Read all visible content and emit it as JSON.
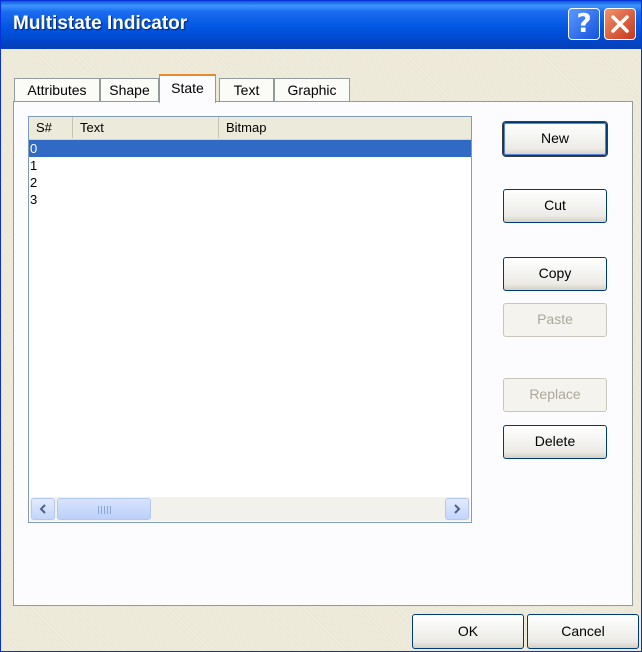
{
  "window": {
    "title": "Multistate Indicator"
  },
  "titlebar": {
    "help_label": "?"
  },
  "tabs": [
    {
      "label": "Attributes",
      "active": false
    },
    {
      "label": "Shape",
      "active": false
    },
    {
      "label": "State",
      "active": true
    },
    {
      "label": "Text",
      "active": false
    },
    {
      "label": "Graphic",
      "active": false
    }
  ],
  "list": {
    "columns": [
      "S#",
      "Text",
      "Bitmap"
    ],
    "rows": [
      {
        "sn": "0",
        "text": "",
        "bitmap": "",
        "selected": true
      },
      {
        "sn": "1",
        "text": "",
        "bitmap": "",
        "selected": false
      },
      {
        "sn": "2",
        "text": "",
        "bitmap": "",
        "selected": false
      },
      {
        "sn": "3",
        "text": "",
        "bitmap": "",
        "selected": false
      }
    ],
    "scroll": {
      "left_icon": "arrow-left-icon",
      "right_icon": "arrow-right-icon",
      "grip_icon": "grip-icon"
    }
  },
  "buttons": {
    "new": {
      "label": "New",
      "enabled": true,
      "default": true
    },
    "cut": {
      "label": "Cut",
      "enabled": true
    },
    "copy": {
      "label": "Copy",
      "enabled": true
    },
    "paste": {
      "label": "Paste",
      "enabled": false
    },
    "replace": {
      "label": "Replace",
      "enabled": false
    },
    "delete": {
      "label": "Delete",
      "enabled": true
    }
  },
  "footer": {
    "ok": "OK",
    "cancel": "Cancel"
  },
  "colors": {
    "titlebar": "#0054e3",
    "selection": "#316ac5",
    "tab_highlight": "#e68b2c",
    "close_button": "#d9531f"
  }
}
